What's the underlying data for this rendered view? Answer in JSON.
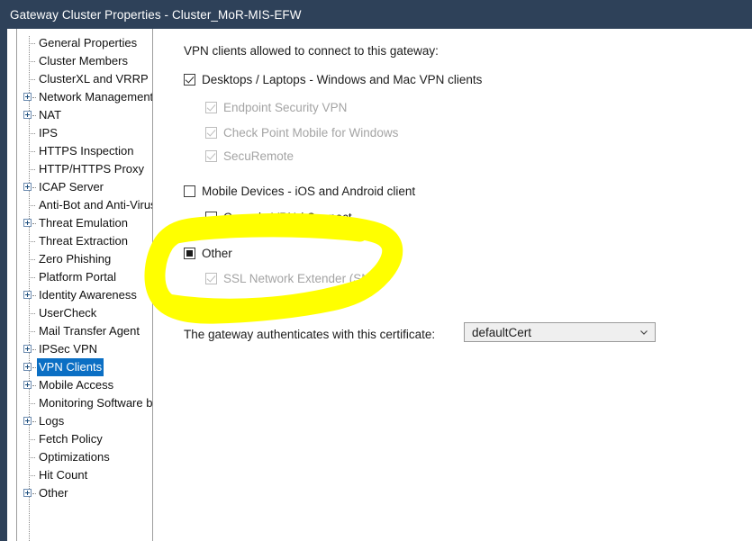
{
  "window": {
    "title": "Gateway Cluster Properties - Cluster_MoR-MIS-EFW"
  },
  "colors": {
    "titlebar_bg": "#2e4159",
    "selection_blue": "#0b6fc4",
    "highlighter_yellow": "#ffff00",
    "dropdown_bg": "#efefef"
  },
  "sidebar": {
    "items": [
      {
        "label": "General Properties",
        "expandable": false,
        "selected": false
      },
      {
        "label": "Cluster Members",
        "expandable": false,
        "selected": false
      },
      {
        "label": "ClusterXL and VRRP",
        "expandable": false,
        "selected": false
      },
      {
        "label": "Network Management",
        "expandable": true,
        "selected": false
      },
      {
        "label": "NAT",
        "expandable": true,
        "selected": false
      },
      {
        "label": "IPS",
        "expandable": false,
        "selected": false
      },
      {
        "label": "HTTPS Inspection",
        "expandable": false,
        "selected": false
      },
      {
        "label": "HTTP/HTTPS Proxy",
        "expandable": false,
        "selected": false
      },
      {
        "label": "ICAP Server",
        "expandable": true,
        "selected": false
      },
      {
        "label": "Anti-Bot and Anti-Virus",
        "expandable": false,
        "selected": false
      },
      {
        "label": "Threat Emulation",
        "expandable": true,
        "selected": false
      },
      {
        "label": "Threat Extraction",
        "expandable": false,
        "selected": false
      },
      {
        "label": "Zero Phishing",
        "expandable": false,
        "selected": false
      },
      {
        "label": "Platform Portal",
        "expandable": false,
        "selected": false
      },
      {
        "label": "Identity Awareness",
        "expandable": true,
        "selected": false
      },
      {
        "label": "UserCheck",
        "expandable": false,
        "selected": false
      },
      {
        "label": "Mail Transfer Agent",
        "expandable": false,
        "selected": false
      },
      {
        "label": "IPSec VPN",
        "expandable": true,
        "selected": false
      },
      {
        "label": "VPN Clients",
        "expandable": true,
        "selected": true
      },
      {
        "label": "Mobile Access",
        "expandable": true,
        "selected": false
      },
      {
        "label": "Monitoring Software b",
        "expandable": false,
        "selected": false
      },
      {
        "label": "Logs",
        "expandable": true,
        "selected": false
      },
      {
        "label": "Fetch Policy",
        "expandable": false,
        "selected": false
      },
      {
        "label": "Optimizations",
        "expandable": false,
        "selected": false
      },
      {
        "label": "Hit Count",
        "expandable": false,
        "selected": false
      },
      {
        "label": "Other",
        "expandable": true,
        "selected": false
      }
    ]
  },
  "main": {
    "intro": "VPN clients allowed to connect to this gateway:",
    "options": [
      {
        "label": "Desktops / Laptops - Windows and Mac VPN clients",
        "state": "checked",
        "disabled": false,
        "indent": 0
      },
      {
        "label": "Endpoint Security VPN",
        "state": "checked",
        "disabled": true,
        "indent": 1
      },
      {
        "label": "Check Point Mobile for Windows",
        "state": "checked",
        "disabled": true,
        "indent": 1
      },
      {
        "label": "SecuRemote",
        "state": "checked",
        "disabled": true,
        "indent": 1
      },
      {
        "label": "Mobile Devices - iOS and Android client",
        "state": "unchecked",
        "disabled": false,
        "indent": 0
      },
      {
        "label": "Capsule VPN / Connect",
        "state": "unchecked",
        "disabled": false,
        "indent": 1
      },
      {
        "label": "Other",
        "state": "indeterminate",
        "disabled": false,
        "indent": 0
      },
      {
        "label": "SSL Network Extender (SNX)",
        "state": "checked",
        "disabled": true,
        "indent": 1
      }
    ],
    "certificate": {
      "label": "The gateway authenticates with this certificate:",
      "value": "defaultCert",
      "chevron_icon": "chevron-down-icon"
    }
  },
  "annotation": {
    "type": "highlighter-oval",
    "color": "#ffff00",
    "targets": "Other / SSL Network Extender (SNX)"
  }
}
